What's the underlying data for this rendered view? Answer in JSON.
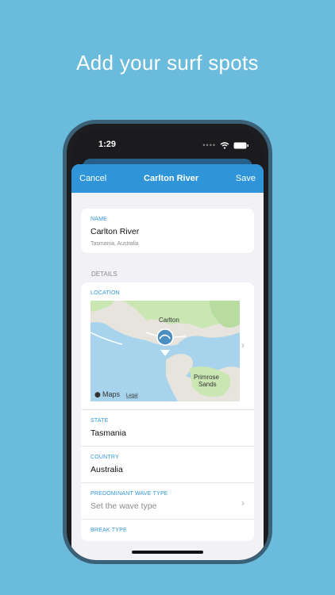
{
  "headline": "Add your surf spots",
  "status": {
    "time": "1:29"
  },
  "nav": {
    "cancel": "Cancel",
    "title": "Carlton River",
    "save": "Save"
  },
  "name_card": {
    "label": "NAME",
    "value": "Carlton River",
    "subtitle": "Tasmania, Australia"
  },
  "details": {
    "header": "DETAILS",
    "location_label": "LOCATION",
    "map": {
      "place1": "Carlton",
      "place2a": "Primrose",
      "place2b": "Sands",
      "maps_brand": "Maps",
      "legal": "Legal"
    },
    "state_label": "STATE",
    "state_value": "Tasmania",
    "country_label": "COUNTRY",
    "country_value": "Australia",
    "wave_label": "PREDOMINANT WAVE TYPE",
    "wave_placeholder": "Set the wave type",
    "break_label": "BREAK TYPE"
  },
  "colors": {
    "accent": "#2f95d8",
    "background": "#6bbbdc"
  }
}
